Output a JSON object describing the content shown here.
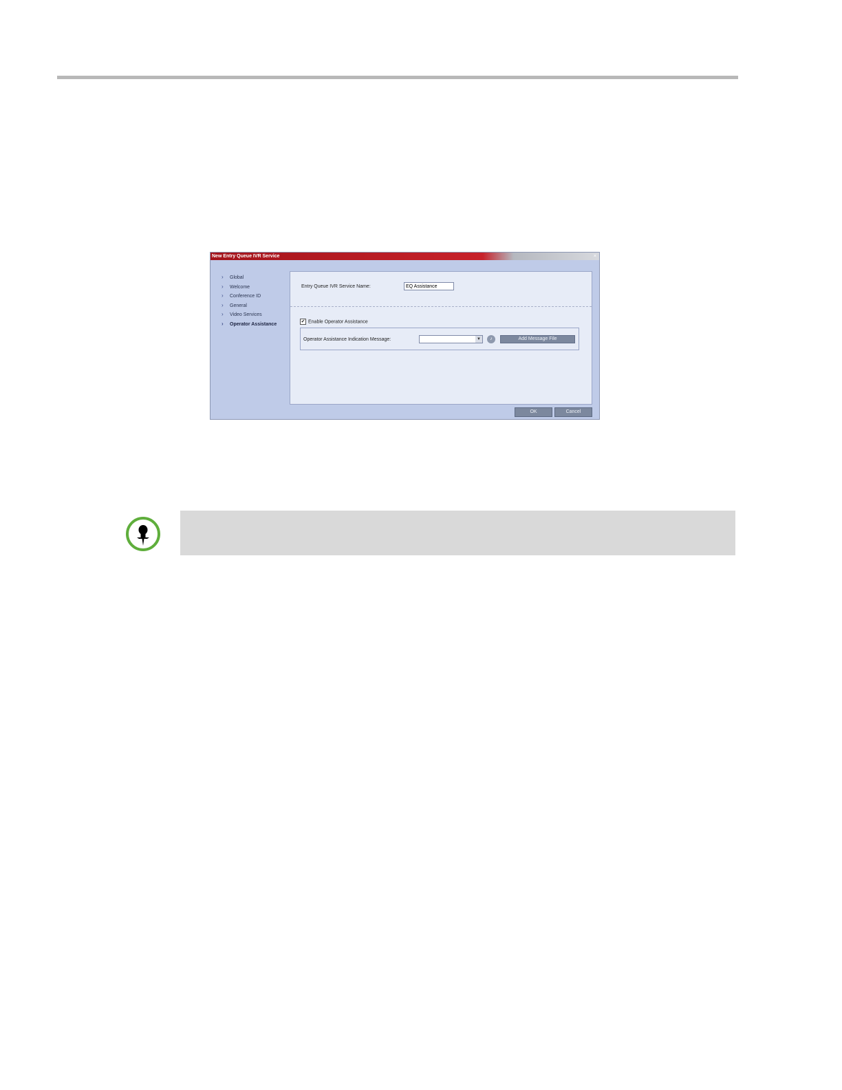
{
  "dialog": {
    "title": "New Entry Queue IVR Service",
    "close_glyph": "×",
    "nav": [
      {
        "label": "Global",
        "active": false
      },
      {
        "label": "Welcome",
        "active": false
      },
      {
        "label": "Conference ID",
        "active": false
      },
      {
        "label": "General",
        "active": false
      },
      {
        "label": "Video Services",
        "active": false
      },
      {
        "label": "Operator Assistance",
        "active": true
      }
    ],
    "nav_chevron": "›",
    "service_name_label": "Entry Queue IVR Service Name:",
    "service_name_value": "EQ Assistance",
    "enable_checkbox_label": "Enable Operator Assistance",
    "enable_checked_glyph": "✔",
    "indication_label": "Operator Assistance Indication Message:",
    "indication_value": "",
    "dropdown_arrow": "▼",
    "play_glyph": "♪",
    "add_message_label": "Add Message File",
    "ok_label": "OK",
    "cancel_label": "Cancel"
  },
  "note": {
    "icon": "pushpin-icon",
    "icon_color": "#5fae3c"
  },
  "colors": {
    "titlebar_red": "#c7212b",
    "dialog_bg": "#bfcbe8",
    "content_bg": "#e7ecf7",
    "button_bg": "#7c889e",
    "note_bg": "#d9d9d9"
  }
}
